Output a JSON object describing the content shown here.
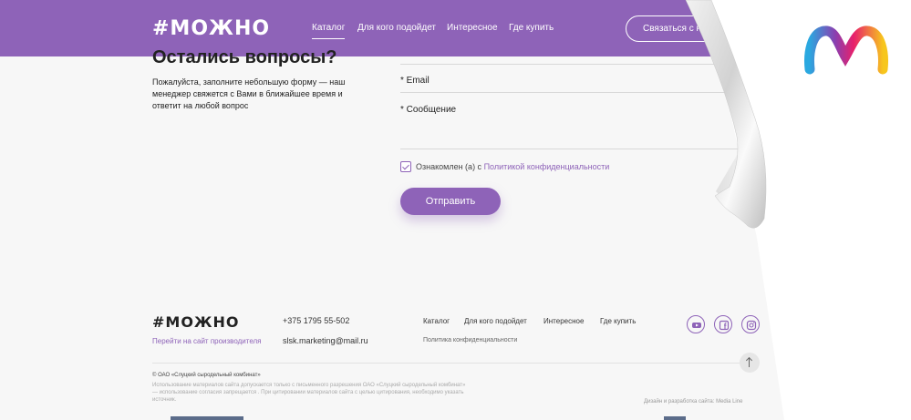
{
  "header": {
    "logo": "#МОЖНО",
    "nav": [
      "Каталог",
      "Для кого подойдет",
      "Интересное",
      "Где купить"
    ],
    "contact_button": "Связаться с на"
  },
  "form": {
    "title": "Остались вопросы?",
    "description": "Пожалуйста, заполните небольшую форму — наш менеджер свяжется с Вами в ближайшее время и ответит на любой вопрос",
    "email_label": "* Email",
    "message_label": "* Сообщение",
    "agree_text": "Ознакомлен (а) с ",
    "agree_link": "Политикой конфиденциальности",
    "agree_checked": true,
    "submit": "Отправить"
  },
  "footer": {
    "logo": "#МОЖНО",
    "producer_link": "Перейти на сайт производителя",
    "phone": "+375 1795 55-502",
    "email": "slsk.marketing@mail.ru",
    "nav": [
      "Каталог",
      "Для кого подойдет",
      "Интересное",
      "Где купить"
    ],
    "privacy": "Политика конфиденциальности",
    "social_icons": [
      "youtube-icon",
      "facebook-icon",
      "instagram-icon"
    ],
    "copyright": "© ОАО «Слуцкий сыродельный комбинат»",
    "legal": "Использование материалов сайта допускается только с письменного разрешения ОАО «Слуцкий сыродельный комбинат» — использование согласия запрещается . При цитировании материалов сайта с целью цитирования, необходимо указать источник.",
    "credit": "Дизайн и разработка сайта: Media Line"
  },
  "colors": {
    "accent": "#8e63b8",
    "background": "#f7f7f7"
  }
}
